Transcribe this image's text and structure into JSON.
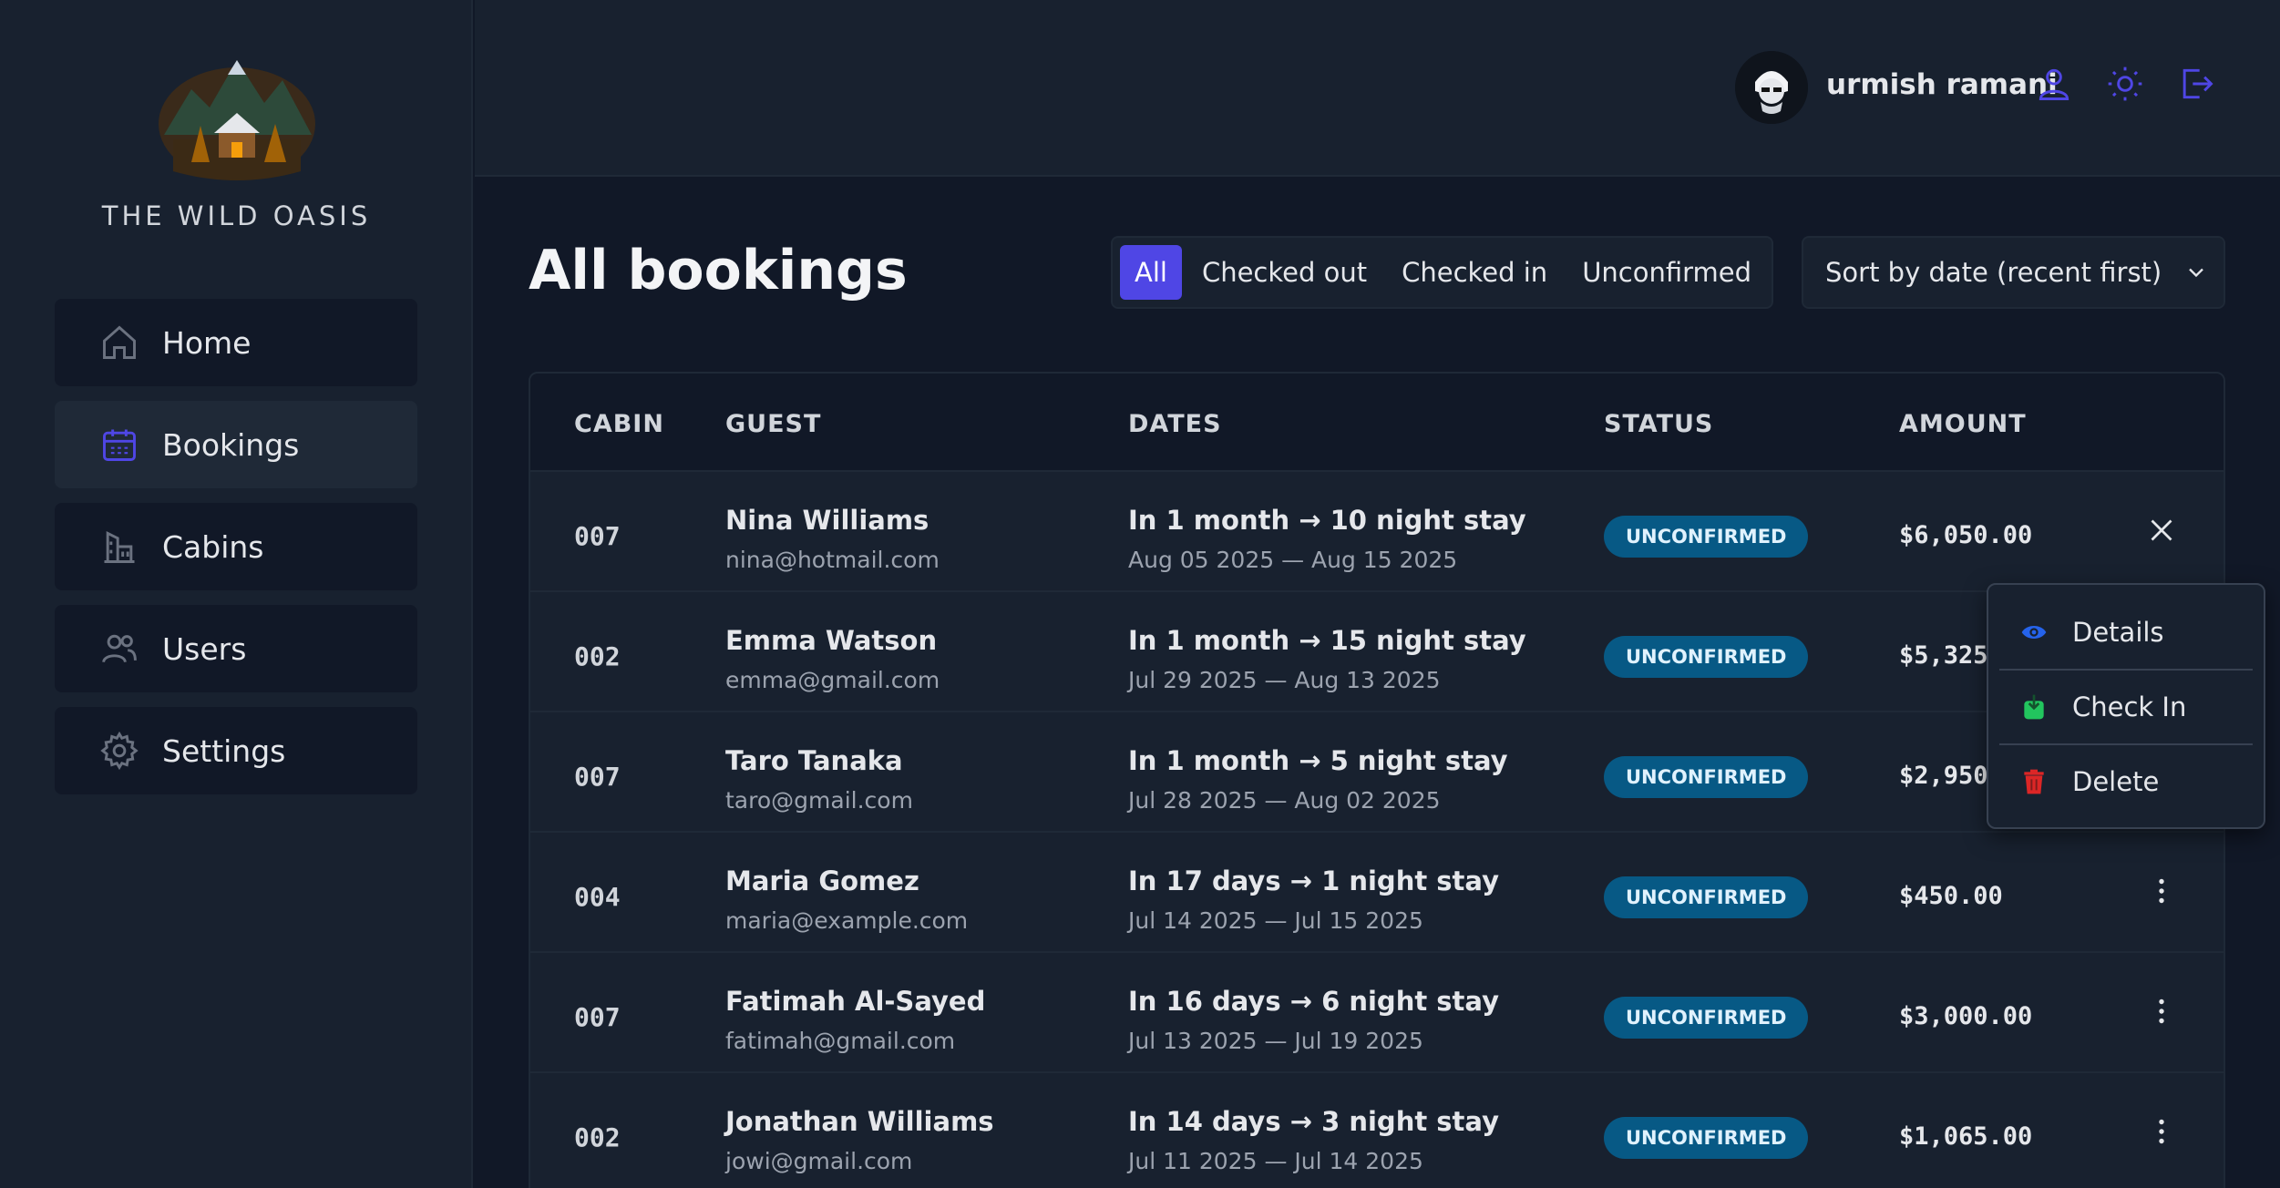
{
  "sidebar": {
    "brand": "THE WILD OASIS",
    "items": [
      {
        "label": "Home",
        "icon": "home-icon"
      },
      {
        "label": "Bookings",
        "icon": "calendar-icon",
        "active": true
      },
      {
        "label": "Cabins",
        "icon": "cabins-icon"
      },
      {
        "label": "Users",
        "icon": "users-icon"
      },
      {
        "label": "Settings",
        "icon": "gear-icon"
      }
    ]
  },
  "header": {
    "username": "urmish ramani",
    "icons": [
      "user-icon",
      "sun-icon",
      "logout-icon"
    ]
  },
  "main": {
    "title": "All bookings",
    "filters": [
      "All",
      "Checked out",
      "Checked in",
      "Unconfirmed"
    ],
    "active_filter": "All",
    "sort_label": "Sort by date (recent first)"
  },
  "table": {
    "headers": [
      "CABIN",
      "GUEST",
      "DATES",
      "STATUS",
      "AMOUNT"
    ],
    "rows": [
      {
        "cabin": "007",
        "name": "Nina Williams",
        "email": "nina@hotmail.com",
        "dates": "In 1 month → 10 night stay",
        "range": "Aug 05 2025 — Aug 15 2025",
        "status": "UNCONFIRMED",
        "amount": "$6,050.00"
      },
      {
        "cabin": "002",
        "name": "Emma Watson",
        "email": "emma@gmail.com",
        "dates": "In 1 month → 15 night stay",
        "range": "Jul 29 2025 — Aug 13 2025",
        "status": "UNCONFIRMED",
        "amount": "$5,325"
      },
      {
        "cabin": "007",
        "name": "Taro Tanaka",
        "email": "taro@gmail.com",
        "dates": "In 1 month → 5 night stay",
        "range": "Jul 28 2025 — Aug 02 2025",
        "status": "UNCONFIRMED",
        "amount": "$2,950"
      },
      {
        "cabin": "004",
        "name": "Maria Gomez",
        "email": "maria@example.com",
        "dates": "In 17 days → 1 night stay",
        "range": "Jul 14 2025 — Jul 15 2025",
        "status": "UNCONFIRMED",
        "amount": "$450.00"
      },
      {
        "cabin": "007",
        "name": "Fatimah Al-Sayed",
        "email": "fatimah@gmail.com",
        "dates": "In 16 days → 6 night stay",
        "range": "Jul 13 2025 — Jul 19 2025",
        "status": "UNCONFIRMED",
        "amount": "$3,000.00"
      },
      {
        "cabin": "002",
        "name": "Jonathan Williams",
        "email": "jowi@gmail.com",
        "dates": "In 14 days → 3 night stay",
        "range": "Jul 11 2025 — Jul 14 2025",
        "status": "UNCONFIRMED",
        "amount": "$1,065.00"
      }
    ]
  },
  "menu": {
    "items": [
      {
        "label": "Details",
        "icon": "eye-icon"
      },
      {
        "label": "Check In",
        "icon": "check-in-icon"
      },
      {
        "label": "Delete",
        "icon": "trash-icon"
      }
    ]
  },
  "colors": {
    "accent": "#4f46e5",
    "badge": "#075985",
    "icon_accent": "#4f46e5"
  }
}
